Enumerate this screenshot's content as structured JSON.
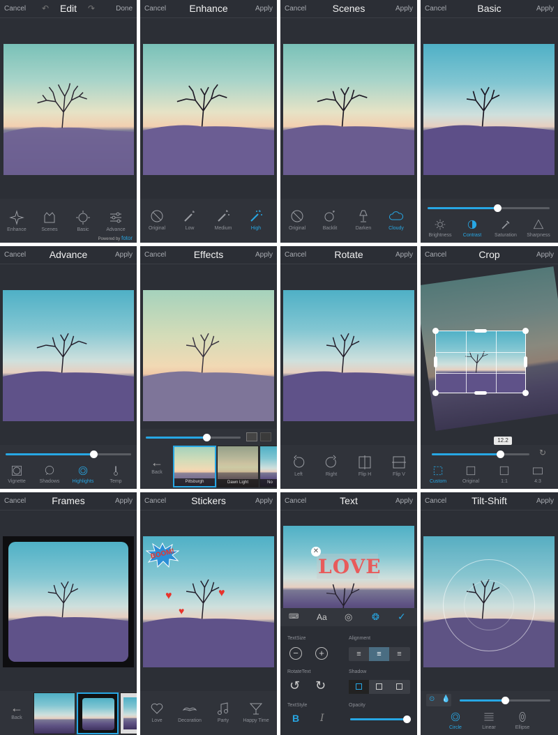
{
  "panels": {
    "edit": {
      "title": "Edit",
      "left": "Cancel",
      "right": "Done",
      "tools": [
        "Enhance",
        "Scenes",
        "Basic",
        "Advance"
      ],
      "powered": "Powered by",
      "brand": "fotor"
    },
    "enhance": {
      "title": "Enhance",
      "left": "Cancel",
      "right": "Apply",
      "tools": [
        "Original",
        "Low",
        "Medium",
        "High"
      ]
    },
    "scenes": {
      "title": "Scenes",
      "left": "Cancel",
      "right": "Apply",
      "tools": [
        "Original",
        "Backlit",
        "Darken",
        "Cloudy"
      ]
    },
    "basic": {
      "title": "Basic",
      "left": "Cancel",
      "right": "Apply",
      "tools": [
        "Brightness",
        "Contrast",
        "Saturation",
        "Sharpness"
      ],
      "slider": 0.57
    },
    "advance": {
      "title": "Advance",
      "left": "Cancel",
      "right": "Apply",
      "tools": [
        "Vignette",
        "Shadows",
        "Highlights",
        "Temp"
      ],
      "slider": 0.7
    },
    "effects": {
      "title": "Effects",
      "left": "Cancel",
      "right": "Apply",
      "back": "Back",
      "thumbs": [
        "Pittsburgh",
        "Dawn Light",
        "No"
      ],
      "slider": 0.64
    },
    "rotate": {
      "title": "Rotate",
      "left": "Cancel",
      "right": "Apply",
      "tools": [
        "Left",
        "Right",
        "Flip H",
        "Flip V"
      ]
    },
    "crop": {
      "title": "Crop",
      "left": "Cancel",
      "right": "Apply",
      "tools": [
        "Custom",
        "Original",
        "1:1",
        "4:3"
      ],
      "value": "12.2",
      "slider": 0.7
    },
    "frames": {
      "title": "Frames",
      "left": "Cancel",
      "right": "Apply",
      "back": "Back"
    },
    "stickers": {
      "title": "Stickers",
      "left": "Cancel",
      "right": "Apply",
      "tools": [
        "Love",
        "Decoration",
        "Party",
        "Happy Time"
      ],
      "sticker_word": "BOOM!"
    },
    "text": {
      "title": "Text",
      "left": "Cancel",
      "right": "Apply",
      "sticker_word": "LOVE",
      "font_tab": "Aa",
      "textsize": "TextSize",
      "alignment": "Alignment",
      "rotatetext": "RotateText",
      "shadow": "Shadow",
      "textstyle": "TextStyle",
      "opacity": "Opacity",
      "bold": "B",
      "italic": "I",
      "opacity_value": 0.95
    },
    "tiltshift": {
      "title": "Tilt-Shift",
      "left": "Cancel",
      "right": "Apply",
      "tools": [
        "Circle",
        "Linear",
        "Ellipse"
      ],
      "slider": 0.5
    }
  },
  "colors": {
    "accent": "#27a7e4",
    "panel": "#2c2f36",
    "header": "#2b2e35"
  }
}
